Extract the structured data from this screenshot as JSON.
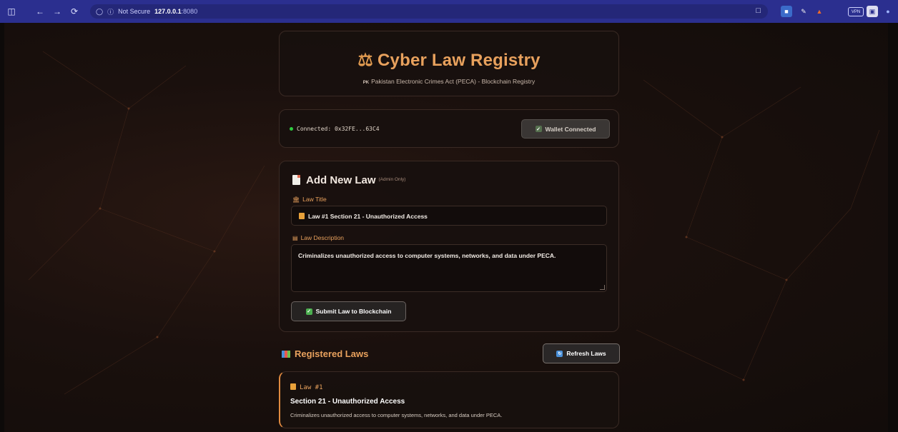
{
  "browser": {
    "security_label": "Not Secure",
    "host": "127.0.0.1",
    "port": ":8080"
  },
  "header": {
    "title": "Cyber Law Registry",
    "flag_code": "PK",
    "subtitle": "Pakistan Electronic Crimes Act (PECA) - Blockchain Registry"
  },
  "wallet": {
    "status": "Connected: 0x32FE...63C4",
    "button_label": "Wallet Connected"
  },
  "form": {
    "title": "Add New Law",
    "admin_note": "(Admin Only)",
    "title_label": "Law Title",
    "title_value": "Law #1 Section 21 - Unauthorized Access",
    "description_label": "Law Description",
    "description_value": "Criminalizes unauthorized access to computer systems, networks, and data under PECA.",
    "submit_label": "Submit Law to Blockchain"
  },
  "registry": {
    "title": "Registered Laws",
    "refresh_label": "Refresh Laws",
    "laws": [
      {
        "number": "Law #1",
        "heading": "Section 21 - Unauthorized Access",
        "description": "Criminalizes unauthorized access to computer systems, networks, and data under PECA."
      }
    ]
  },
  "colors": {
    "accent": "#e8a15d",
    "chrome": "#2b2f8f",
    "connected_dot": "#2ecc40"
  }
}
